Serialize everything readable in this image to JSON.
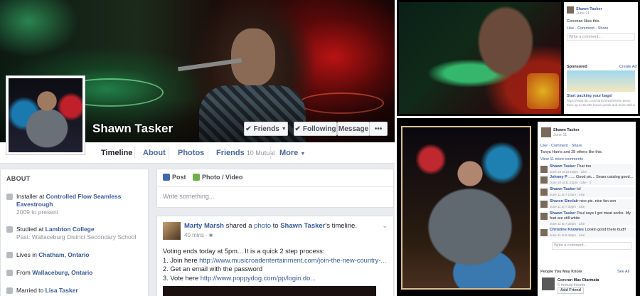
{
  "profile": {
    "name": "Shawn Tasker",
    "buttons": {
      "friends": "Friends",
      "following": "Following",
      "message": "Message",
      "more": "•••"
    }
  },
  "tabs": [
    {
      "label": "Timeline"
    },
    {
      "label": "About"
    },
    {
      "label": "Photos"
    },
    {
      "label": "Friends",
      "sub": "10 Mutual"
    },
    {
      "label": "More"
    }
  ],
  "about": {
    "heading": "ABOUT",
    "work": {
      "prefix": "Installer at ",
      "link": "Controlled Flow Seamless Eavestrough",
      "sub": "2009 to present"
    },
    "education": {
      "prefix": "Studied at ",
      "link": "Lambton College",
      "sub": "Past: Wallaceburg District Secondary School"
    },
    "lives": {
      "prefix": "Lives in ",
      "link": "Chatham, Ontario"
    },
    "from": {
      "prefix": "From ",
      "link": "Wallaceburg, Ontario"
    },
    "married": {
      "prefix": "Married to ",
      "link": "Lisa Tasker"
    }
  },
  "composer": {
    "post_tab": "Post",
    "photo_tab": "Photo / Video",
    "placeholder": "Write something..."
  },
  "post": {
    "author": "Marty Marsh",
    "action_mid": " shared a ",
    "action_link": "photo",
    "action_to": " to ",
    "target": "Shawn Tasker",
    "target_suffix": "'s timeline.",
    "time": "40 mins",
    "line1": "Voting ends today at 5pm... It is a quick 2 step process:",
    "line2_prefix": "1. Join here ",
    "line2_link": "http://www.musicroadentertainment.com/join-the-new-country-...",
    "line3": "2. Get an email with the password",
    "line4_prefix": "3. Vote here ",
    "line4_link": "http://www.poppydog.com/pp/login.do..."
  },
  "viewer_top": {
    "name": "Shawn Tasker",
    "date": "June 11",
    "liked": "Corcoran likes this.",
    "actions": "Like · Comment · Share",
    "write": "Write a comment...",
    "sponsored": "Sponsored",
    "create_ad": "Create Ad",
    "ad_title": "Start packing your bags!",
    "ad_url": "https://www.rbc.com/cards/rewards/rbc-avion",
    "ad_text": "Earn up to 35,000 bonus points and more with an RBC travel card."
  },
  "viewer_bottom": {
    "name": "Shawn Tasker",
    "date": "June 11",
    "actions": "Like · Comment · Share",
    "likes": "Tanya Harris and 28 others like this.",
    "more_comments": "View 11 more comments",
    "comments": [
      {
        "name": "Shawn Tasker",
        "text": "That too",
        "meta": "June 10 at 10:10pm · Like"
      },
      {
        "name": "Johnny P",
        "text": "...... Good pic... Sears catalog good...",
        "meta": "June 10 at 11:13pm · Like · 1"
      },
      {
        "name": "Shawn Tasker",
        "text": "lol",
        "meta": "June 11 at 7:14am · Like"
      },
      {
        "name": "Sharon Sinclair",
        "text": "nice pic. nice fan son",
        "meta": "June 11 at 7:30pm · Like"
      },
      {
        "name": "Shawn Tasker",
        "text": "Paul says I got meat socks. My feet are still white",
        "meta": "June 11 at 7:32pm · Like"
      },
      {
        "name": "Christine Knowles",
        "text": "Lookin good there bud!!",
        "meta": "June 11 at 5:49pm · Like"
      }
    ],
    "write": "Write a comment...",
    "pymk": "People You May Know",
    "see_all": "See All",
    "suggest_name": "Corcran Mac Diarmata",
    "suggest_sub": "6 mutual friends",
    "add_friend": "Add Friend"
  }
}
